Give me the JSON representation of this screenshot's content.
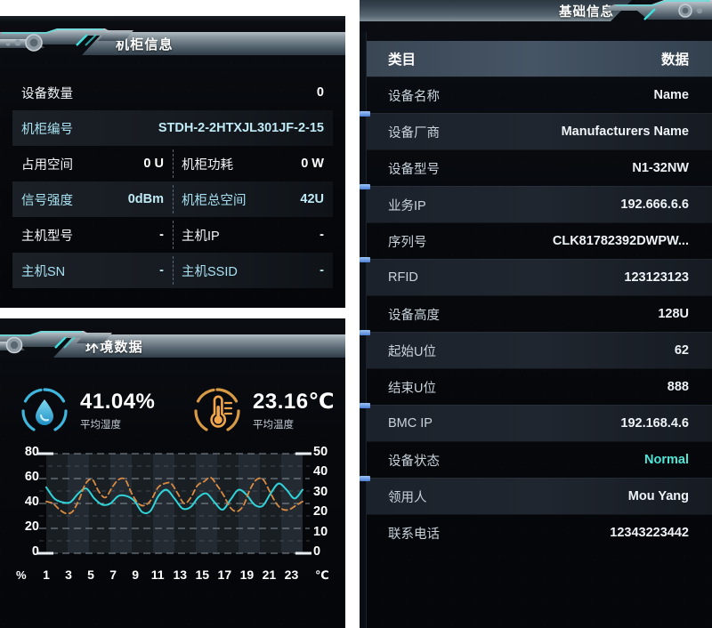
{
  "cabinet_panel": {
    "title": "机柜信息",
    "rows": [
      {
        "cells": [
          {
            "label": "设备数量",
            "value": "0",
            "label_style": "w",
            "value_style": "w"
          }
        ],
        "alt": false,
        "full": true
      },
      {
        "cells": [
          {
            "label": "机柜编号",
            "value": "STDH-2-2HTXJL301JF-2-15",
            "label_style": "c",
            "value_style": "c"
          }
        ],
        "alt": true,
        "full": true
      },
      {
        "cells": [
          {
            "label": "占用空间",
            "value": "0 U",
            "label_style": "w",
            "value_style": "w"
          },
          {
            "label": "机柜功耗",
            "value": "0 W",
            "label_style": "w",
            "value_style": "w"
          }
        ],
        "alt": false,
        "full": false
      },
      {
        "cells": [
          {
            "label": "信号强度",
            "value": "0dBm",
            "label_style": "c",
            "value_style": "c"
          },
          {
            "label": "机柜总空间",
            "value": "42U",
            "label_style": "c",
            "value_style": "c"
          }
        ],
        "alt": true,
        "full": false
      },
      {
        "cells": [
          {
            "label": "主机型号",
            "value": "-",
            "label_style": "w",
            "value_style": "w"
          },
          {
            "label": "主机IP",
            "value": "-",
            "label_style": "w",
            "value_style": "w"
          }
        ],
        "alt": false,
        "full": false
      },
      {
        "cells": [
          {
            "label": "主机SN",
            "value": "-",
            "label_style": "c",
            "value_style": "c"
          },
          {
            "label": "主机SSID",
            "value": "-",
            "label_style": "c",
            "value_style": "c"
          }
        ],
        "alt": true,
        "full": false
      }
    ]
  },
  "env_panel": {
    "title": "环境数据",
    "gauges": [
      {
        "icon": "humidity-drop-icon",
        "value": "41.04%",
        "label": "平均湿度",
        "color": "#35b9e0"
      },
      {
        "icon": "thermometer-icon",
        "value": "23.16℃",
        "label": "平均温度",
        "color": "#e8962e"
      }
    ],
    "chart_data": {
      "type": "line",
      "title": "环境数据",
      "xlabel": "",
      "ylabel": "",
      "grid": true,
      "legend": "none",
      "left_axis": {
        "unit": "%",
        "ticks": [
          0,
          20,
          40,
          60,
          80
        ],
        "ylim": [
          0,
          80
        ],
        "series": "平均湿度"
      },
      "right_axis": {
        "unit": "℃",
        "ticks": [
          0,
          10,
          20,
          30,
          40,
          50
        ],
        "ylim": [
          0,
          50
        ],
        "series": "平均温度"
      },
      "x": [
        1,
        2,
        3,
        4,
        5,
        6,
        7,
        8,
        9,
        10,
        11,
        12,
        13,
        14,
        15,
        16,
        17,
        18,
        19,
        20,
        21,
        22,
        23,
        24
      ],
      "xtick_labels": [
        "1",
        "3",
        "5",
        "7",
        "9",
        "11",
        "13",
        "15",
        "17",
        "19",
        "21",
        "23"
      ],
      "series": [
        {
          "name": "湿度",
          "axis": "left",
          "style": "solid",
          "color": "#2fd4d9",
          "values": [
            53,
            44,
            41,
            41,
            48,
            52,
            44,
            39,
            40,
            46,
            46,
            42,
            33,
            34,
            46,
            51,
            44,
            36,
            37,
            45,
            48,
            41,
            35,
            43,
            51,
            47,
            39,
            38,
            48,
            56,
            51,
            44,
            51
          ]
        },
        {
          "name": "温度",
          "axis": "right",
          "style": "dashed",
          "color": "#d98b42",
          "values": [
            26,
            25,
            22,
            20,
            21,
            27,
            35,
            37,
            31,
            28,
            33,
            37,
            37,
            30,
            25,
            24,
            27,
            33,
            35,
            35,
            30,
            25,
            28,
            34,
            36,
            38,
            34,
            29,
            23,
            21,
            24,
            32,
            37,
            37,
            31,
            25,
            22,
            22,
            24,
            26
          ]
        }
      ]
    }
  },
  "info_panel": {
    "title": "基础信息",
    "header": {
      "col_label": "类目",
      "col_value": "数据"
    },
    "rows": [
      {
        "label": "设备名称",
        "value": "Name",
        "alt": false,
        "accent": false
      },
      {
        "label": "设备厂商",
        "value": "Manufacturers Name",
        "alt": true,
        "accent": false
      },
      {
        "label": "设备型号",
        "value": "N1-32NW",
        "alt": false,
        "accent": false
      },
      {
        "label": "业务IP",
        "value": "192.666.6.6",
        "alt": true,
        "accent": false
      },
      {
        "label": "序列号",
        "value": "CLK81782392DWPW...",
        "alt": false,
        "accent": false
      },
      {
        "label": "RFID",
        "value": "123123123",
        "alt": true,
        "accent": false
      },
      {
        "label": "设备高度",
        "value": "128U",
        "alt": false,
        "accent": false
      },
      {
        "label": "起始U位",
        "value": "62",
        "alt": true,
        "accent": false
      },
      {
        "label": "结束U位",
        "value": "888",
        "alt": false,
        "accent": false
      },
      {
        "label": "BMC IP",
        "value": "192.168.4.6",
        "alt": true,
        "accent": false
      },
      {
        "label": "设备状态",
        "value": "Normal",
        "alt": false,
        "accent": true
      },
      {
        "label": "领用人",
        "value": "Mou Yang",
        "alt": true,
        "accent": false
      },
      {
        "label": "联系电话",
        "value": "12343223442",
        "alt": false,
        "accent": false
      }
    ]
  },
  "colors": {
    "accent_cyan": "#4fe6d8",
    "label_cyan": "#a8e2f2",
    "humidity": "#2fd4d9",
    "temperature": "#d98b42",
    "marker_blue": "#7aa8e8"
  }
}
